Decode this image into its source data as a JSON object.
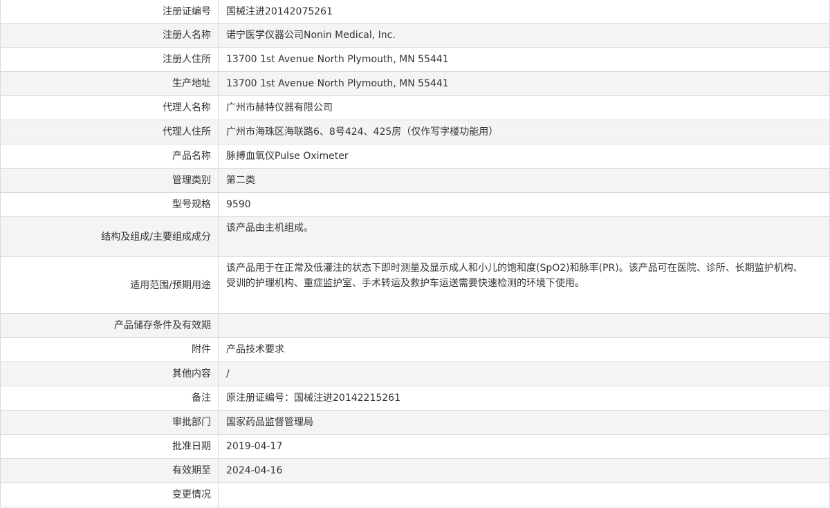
{
  "rows": [
    {
      "label": "注册证编号",
      "value": "国械注进20142075261"
    },
    {
      "label": "注册人名称",
      "value": "诺宁医学仪器公司Nonin Medical, Inc."
    },
    {
      "label": "注册人住所",
      "value": "13700 1st Avenue North Plymouth, MN 55441"
    },
    {
      "label": "生产地址",
      "value": "13700 1st Avenue North Plymouth, MN 55441"
    },
    {
      "label": "代理人名称",
      "value": "广州市赫特仪器有限公司"
    },
    {
      "label": "代理人住所",
      "value": "广州市海珠区海联路6、8号424、425房（仅作写字楼功能用）"
    },
    {
      "label": "产品名称",
      "value": "脉搏血氧仪Pulse Oximeter"
    },
    {
      "label": "管理类别",
      "value": "第二类"
    },
    {
      "label": "型号规格",
      "value": "9590"
    },
    {
      "label": "结构及组成/主要组成成分",
      "value": "该产品由主机组成。"
    },
    {
      "label": "适用范围/预期用途",
      "value": "该产品用于在正常及低灌注的状态下即时测量及显示成人和小儿的饱和度(SpO2)和脉率(PR)。该产品可在医院、诊所、长期监护机构、受训的护理机构、重症监护室、手术转运及救护车运送需要快速检测的环境下使用。"
    },
    {
      "label": "产品储存条件及有效期",
      "value": ""
    },
    {
      "label": "附件",
      "value": "产品技术要求"
    },
    {
      "label": "其他内容",
      "value": "/"
    },
    {
      "label": "备注",
      "value": "原注册证编号：国械注进20142215261"
    },
    {
      "label": "审批部门",
      "value": "国家药品监督管理局"
    },
    {
      "label": "批准日期",
      "value": "2019-04-17"
    },
    {
      "label": "有效期至",
      "value": "2024-04-16"
    },
    {
      "label": "变更情况",
      "value": ""
    }
  ]
}
